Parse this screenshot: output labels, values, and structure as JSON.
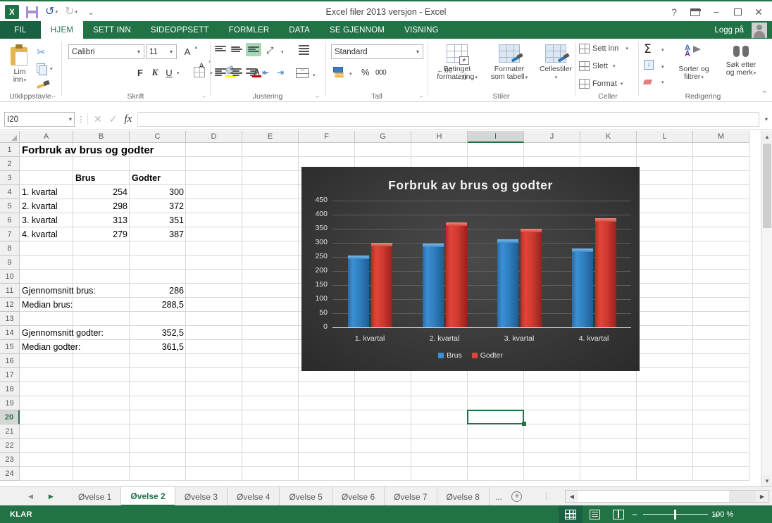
{
  "window": {
    "title": "Excel filer 2013 versjon - Excel",
    "help_icon": "?",
    "ribbon_display_icon": "ribbon-display",
    "minimize_icon": "−",
    "restore_icon": "□",
    "close_icon": "✕",
    "signin_label": "Logg på"
  },
  "qat": {
    "logo_text": "X",
    "save_icon": "save-icon",
    "undo_icon": "undo-icon",
    "redo_icon": "redo-icon",
    "customize_icon": "customize-icon"
  },
  "ribbon_tabs": {
    "file_label": "FIL",
    "items": [
      {
        "label": "HJEM",
        "active": true
      },
      {
        "label": "SETT INN",
        "active": false
      },
      {
        "label": "SIDEOPPSETT",
        "active": false
      },
      {
        "label": "FORMLER",
        "active": false
      },
      {
        "label": "DATA",
        "active": false
      },
      {
        "label": "SE GJENNOM",
        "active": false
      },
      {
        "label": "VISNING",
        "active": false
      }
    ]
  },
  "ribbon": {
    "clipboard": {
      "group_label": "Utklippstavle",
      "paste_label": "Lim\ninn",
      "paste_line1": "Lim",
      "paste_line2": "inn",
      "cut_label": "cut-icon",
      "copy_label": "copy-icon",
      "format_painter_label": "format-painter-icon"
    },
    "font": {
      "group_label": "Skrift",
      "font_name": "Calibri",
      "font_size": "11",
      "grow_font": "A",
      "shrink_font": "A",
      "bold": "F",
      "italic": "K",
      "underline": "U",
      "borders_icon": "borders-icon",
      "fill_color_icon": "fill-color-icon",
      "font_color_icon": "font-color-icon"
    },
    "alignment": {
      "group_label": "Justering",
      "align_top": "align-top-icon",
      "align_middle": "align-middle-icon",
      "align_bottom": "align-bottom-icon",
      "orientation": "orientation-icon",
      "align_left": "align-left-icon",
      "align_center": "align-center-icon",
      "align_right": "align-right-icon",
      "decrease_indent": "decrease-indent-icon",
      "increase_indent": "increase-indent-icon",
      "wrap_text": "wrap-text-icon",
      "merge_center": "merge-center-icon"
    },
    "number": {
      "group_label": "Tall",
      "format": "Standard",
      "currency_icon": "currency-icon",
      "percent": "%",
      "comma": "000",
      "increase_decimal": "increase-decimal-icon",
      "decrease_decimal": "decrease-decimal-icon"
    },
    "styles": {
      "group_label": "Stiler",
      "conditional_l1": "Betinget",
      "conditional_l2": "formatering",
      "table_l1": "Formater",
      "table_l2": "som tabell",
      "cellstyles_l1": "Cellestiler",
      "cellstyles_l2": ""
    },
    "cells": {
      "group_label": "Celler",
      "insert_label": "Sett inn",
      "delete_label": "Slett",
      "format_label": "Format"
    },
    "editing": {
      "group_label": "Redigering",
      "autosum_icon": "sigma-icon",
      "fill_icon": "fill-down-icon",
      "clear_icon": "eraser-icon",
      "sort_l1": "Sorter og",
      "sort_l2": "filtrer",
      "find_l1": "Søk etter",
      "find_l2": "og merk"
    },
    "collapse_icon": "collapse-ribbon-icon"
  },
  "formula_bar": {
    "name_box": "I20",
    "cancel_icon": "✕",
    "enter_icon": "✓",
    "function_icon": "fx",
    "formula_value": "",
    "expand_icon": "expand-formula-bar-icon"
  },
  "grid": {
    "columns": [
      "A",
      "B",
      "C",
      "D",
      "E",
      "F",
      "G",
      "H",
      "I",
      "J",
      "K",
      "L",
      "M"
    ],
    "selected_column": "I",
    "selected_row": "20",
    "rows": [
      "1",
      "2",
      "3",
      "4",
      "5",
      "6",
      "7",
      "8",
      "9",
      "10",
      "11",
      "12",
      "13",
      "14",
      "15",
      "16",
      "17",
      "18",
      "19",
      "20",
      "21",
      "22",
      "23",
      "24"
    ],
    "cells": [
      {
        "row": 1,
        "col": "A",
        "value": "Forbruk av brus og godter",
        "style": "big"
      },
      {
        "row": 3,
        "col": "B",
        "value": "Brus",
        "style": "b"
      },
      {
        "row": 3,
        "col": "C",
        "value": "Godter",
        "style": "b"
      },
      {
        "row": 4,
        "col": "A",
        "value": "1. kvartal",
        "style": ""
      },
      {
        "row": 4,
        "col": "B",
        "value": "254",
        "style": "r"
      },
      {
        "row": 4,
        "col": "C",
        "value": "300",
        "style": "r"
      },
      {
        "row": 5,
        "col": "A",
        "value": "2. kvartal",
        "style": ""
      },
      {
        "row": 5,
        "col": "B",
        "value": "298",
        "style": "r"
      },
      {
        "row": 5,
        "col": "C",
        "value": "372",
        "style": "r"
      },
      {
        "row": 6,
        "col": "A",
        "value": "3. kvartal",
        "style": ""
      },
      {
        "row": 6,
        "col": "B",
        "value": "313",
        "style": "r"
      },
      {
        "row": 6,
        "col": "C",
        "value": "351",
        "style": "r"
      },
      {
        "row": 7,
        "col": "A",
        "value": "4. kvartal",
        "style": ""
      },
      {
        "row": 7,
        "col": "B",
        "value": "279",
        "style": "r"
      },
      {
        "row": 7,
        "col": "C",
        "value": "387",
        "style": "r"
      },
      {
        "row": 11,
        "col": "A",
        "value": "Gjennomsnitt brus:",
        "style": ""
      },
      {
        "row": 11,
        "col": "C",
        "value": "286",
        "style": "r"
      },
      {
        "row": 12,
        "col": "A",
        "value": "Median brus:",
        "style": ""
      },
      {
        "row": 12,
        "col": "C",
        "value": "288,5",
        "style": "r"
      },
      {
        "row": 14,
        "col": "A",
        "value": "Gjennomsnitt godter:",
        "style": ""
      },
      {
        "row": 14,
        "col": "C",
        "value": "352,5",
        "style": "r"
      },
      {
        "row": 15,
        "col": "A",
        "value": "Median godter:",
        "style": ""
      },
      {
        "row": 15,
        "col": "C",
        "value": "361,5",
        "style": "r"
      }
    ]
  },
  "chart_data": {
    "type": "bar",
    "title": "Forbruk av brus og godter",
    "categories": [
      "1. kvartal",
      "2. kvartal",
      "3. kvartal",
      "4. kvartal"
    ],
    "series": [
      {
        "name": "Brus",
        "values": [
          254,
          298,
          313,
          279
        ],
        "color": "#3b8fd4"
      },
      {
        "name": "Godter",
        "values": [
          300,
          372,
          351,
          387
        ],
        "color": "#e0453a"
      }
    ],
    "yticks": [
      0,
      50,
      100,
      150,
      200,
      250,
      300,
      350,
      400,
      450
    ],
    "ylim": [
      0,
      450
    ],
    "xlabel": "",
    "ylabel": "",
    "grid": true,
    "legend_position": "bottom",
    "background": "#3d3d3d"
  },
  "sheet_tabs": {
    "first_icon": "first-sheet-icon",
    "prev_icon": "prev-sheet-icon",
    "items": [
      {
        "label": "Øvelse 1",
        "active": false
      },
      {
        "label": "Øvelse 2",
        "active": true
      },
      {
        "label": "Øvelse 3",
        "active": false
      },
      {
        "label": "Øvelse 4",
        "active": false
      },
      {
        "label": "Øvelse 5",
        "active": false
      },
      {
        "label": "Øvelse 6",
        "active": false
      },
      {
        "label": "Øvelse 7",
        "active": false
      },
      {
        "label": "Øvelse 8",
        "active": false
      }
    ],
    "more_label": "...",
    "add_label": "+"
  },
  "status_bar": {
    "state": "KLAR",
    "view_normal": "normal-view-icon",
    "view_layout": "page-layout-icon",
    "view_break": "page-break-icon",
    "zoom_out": "−",
    "zoom_in": "+",
    "zoom_level": "100 %"
  }
}
